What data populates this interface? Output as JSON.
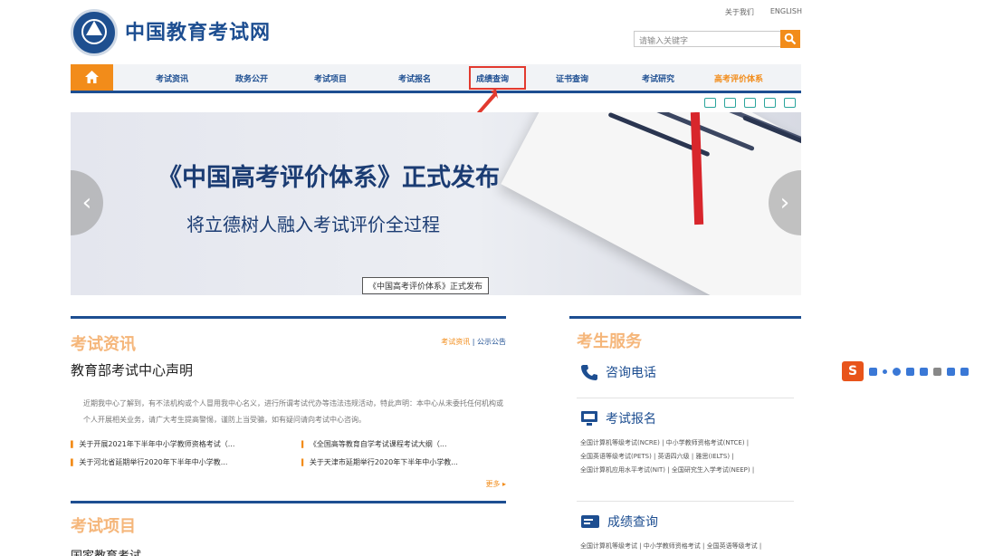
{
  "header": {
    "site_name": "中国教育考试网",
    "top_links": [
      "关于我们",
      "ENGLISH"
    ],
    "search_placeholder": "请输入关键字"
  },
  "nav": {
    "items": [
      "考试资讯",
      "政务公开",
      "考试项目",
      "考试报名",
      "成绩查询",
      "证书查询",
      "考试研究",
      "高考评价体系"
    ],
    "highlighted_index": 4
  },
  "banner": {
    "title": "《中国高考评价体系》正式发布",
    "subtitle": "将立德树人融入考试评价全过程",
    "caption": "《中国高考评价体系》正式发布",
    "prev_symbol": "‹",
    "next_symbol": "›"
  },
  "news": {
    "section_title": "考试资讯",
    "tab_active": "考试资讯",
    "tab_other": "公示公告",
    "headline": "教育部考试中心声明",
    "paragraph": "近期我中心了解到，有不法机构或个人冒用我中心名义，进行所谓考试代办等违法违规活动，特此声明：本中心从未委托任何机构或个人开展相关业务，请广大考生提高警惕，谨防上当受骗，如有疑问请向考试中心咨询。",
    "items": [
      "关于开展2021年下半年中小学教师资格考试（...",
      "《全国高等教育自学考试课程考试大纲（...",
      "关于河北省延期举行2020年下半年中小学教...",
      "关于天津市延期举行2020年下半年中小学教..."
    ],
    "more": "更多 ▸"
  },
  "projects": {
    "section_title": "考试项目",
    "first_item": "国家教育考试"
  },
  "service": {
    "section_title": "考生服务",
    "rows": [
      {
        "label": "咨询电话"
      },
      {
        "label": "考试报名",
        "links": [
          "全国计算机等级考试(NCRE)  |  中小学教师资格考试(NTCE)  |",
          "全国英语等级考试(PETS)  |  英语四六级  |  雅思(IELTS)  |",
          "全国计算机应用水平考试(NIT)  |  全国研究生入学考试(NEEP)  |"
        ]
      },
      {
        "label": "成绩查询",
        "links": [
          "全国计算机等级考试  |  中小学教师资格考试  |  全国英语等级考试  |"
        ]
      }
    ]
  },
  "colors": {
    "primary": "#1d4e91",
    "accent": "#f28c1a",
    "highlight_red": "#e23a2f"
  }
}
